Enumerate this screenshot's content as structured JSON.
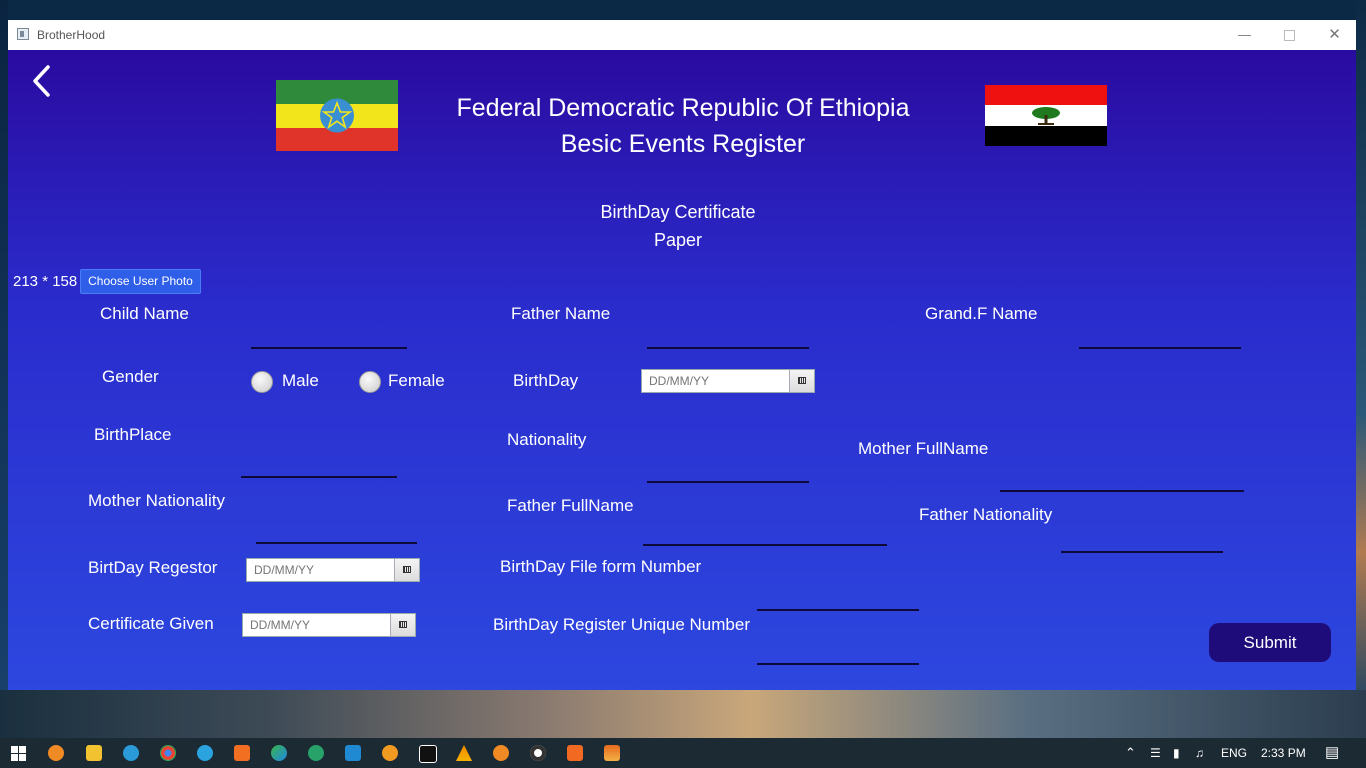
{
  "window": {
    "title": "BrotherHood"
  },
  "header": {
    "line1": "Federal Democratic Republic Of Ethiopia",
    "line2": "Besic Events Register",
    "subtitle1": "BirthDay  Certificate",
    "subtitle2": "Paper"
  },
  "photo": {
    "size_text": "213 * 158",
    "button_label": "Choose User  Photo"
  },
  "form": {
    "child_name": "Child Name",
    "father_name": "Father Name",
    "grandf_name": "Grand.F Name",
    "gender": "Gender",
    "male": "Male",
    "female": "Female",
    "birthday": "BirthDay",
    "birthplace": "BirthPlace",
    "nationality": "Nationality",
    "mother_fullname": "Mother FullName",
    "mother_nationality": "Mother Nationality",
    "father_fullname": "Father FullName",
    "father_nationality": "Father Nationality",
    "birthday_registor": "BirtDay Regestor",
    "birthday_file_form_number": "BirthDay File form Number",
    "certificate_given": "Certificate Given",
    "birthday_register_unique_number": "BirthDay Register  Unique Number",
    "date_placeholder": "DD/MM/YY",
    "submit_label": "Submit"
  },
  "taskbar": {
    "language": "ENG",
    "time": "2:33 PM"
  },
  "icons": {
    "back": "chevron-left-icon",
    "calendar": "calendar-icon"
  },
  "colors": {
    "content_top": "#2a0ba0",
    "content_bottom": "#2d47df",
    "submit_bg": "#1e0c7a",
    "photo_button": "#2f5fe8"
  }
}
